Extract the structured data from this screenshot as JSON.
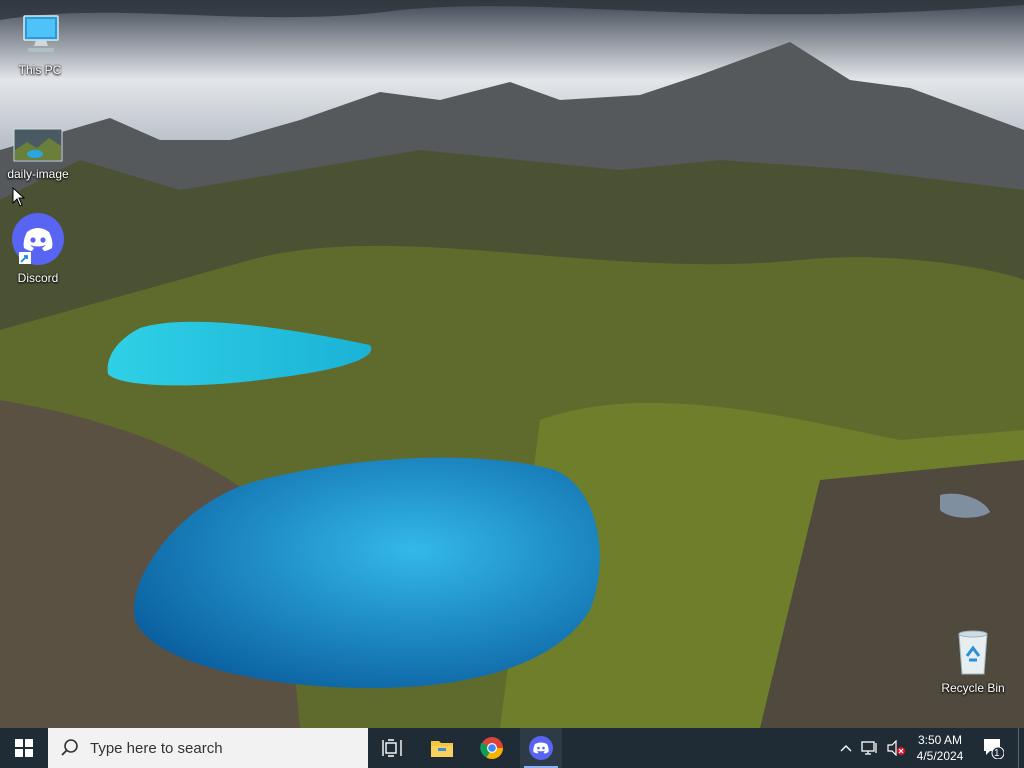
{
  "desktop": {
    "icons": [
      {
        "label": "This PC",
        "icon": "this-pc-icon"
      },
      {
        "label": "daily-image",
        "icon": "image-file-icon"
      },
      {
        "label": "Discord",
        "icon": "discord-icon"
      },
      {
        "label": "Recycle Bin",
        "icon": "recycle-bin-icon"
      }
    ]
  },
  "taskbar": {
    "search_placeholder": "Type here to search",
    "apps": [
      "task-view-icon",
      "file-explorer-icon",
      "chrome-icon",
      "discord-icon"
    ],
    "tray": {
      "time": "3:50 AM",
      "date": "4/5/2024",
      "notification_count": "1"
    }
  },
  "colors": {
    "taskbar_bg": "#1f2b35",
    "discord": "#5865f2",
    "accent": "#8ab4f8"
  }
}
